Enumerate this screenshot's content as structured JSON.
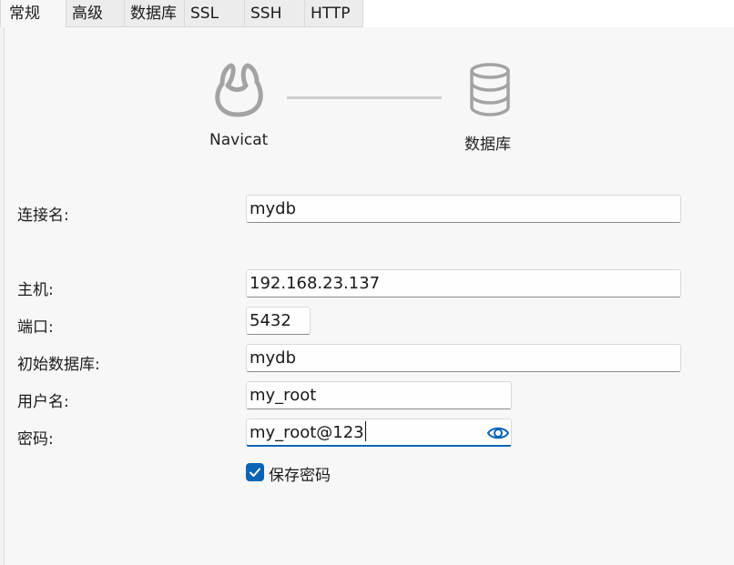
{
  "tabs": [
    {
      "label": "常规",
      "active": true
    },
    {
      "label": "高级"
    },
    {
      "label": "数据库"
    },
    {
      "label": "SSL"
    },
    {
      "label": "SSH"
    },
    {
      "label": "HTTP"
    }
  ],
  "diagram": {
    "left_caption": "Navicat",
    "right_caption": "数据库",
    "left_icon": "navicat-logo-icon",
    "right_icon": "database-icon"
  },
  "form": {
    "connection_name": {
      "label": "连接名:",
      "value": "mydb"
    },
    "host": {
      "label": "主机:",
      "value": "192.168.23.137"
    },
    "port": {
      "label": "端口:",
      "value": "5432"
    },
    "initial_db": {
      "label": "初始数据库:",
      "value": "mydb"
    },
    "username": {
      "label": "用户名:",
      "value": "my_root"
    },
    "password": {
      "label": "密码:",
      "value": "my_root@123",
      "reveal_icon": "eye-icon"
    },
    "save_password": {
      "label": "保存密码",
      "checked": true
    }
  },
  "colors": {
    "accent": "#0a64b4",
    "icon_gray": "#a3a3a3",
    "background": "#f7f7f7"
  }
}
